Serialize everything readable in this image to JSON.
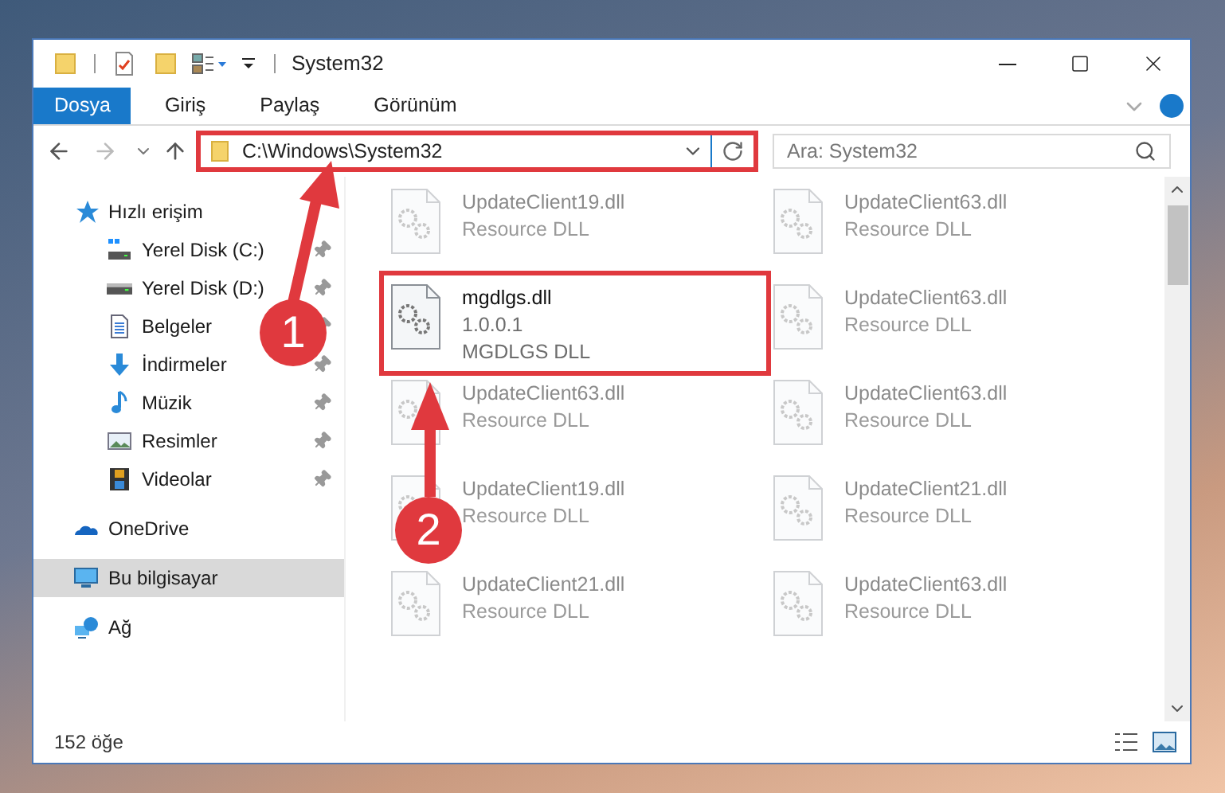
{
  "window": {
    "title": "System32"
  },
  "ribbon_tabs": [
    {
      "label": "Dosya",
      "selected": true
    },
    {
      "label": "Giriş",
      "selected": false
    },
    {
      "label": "Paylaş",
      "selected": false
    },
    {
      "label": "Görünüm",
      "selected": false
    }
  ],
  "address": {
    "path": "C:\\Windows\\System32",
    "highlighted": true
  },
  "search": {
    "placeholder": "Ara: System32"
  },
  "sidebar": {
    "items": [
      {
        "label": "Hızlı erişim",
        "kind": "star",
        "selected": false,
        "children": [
          {
            "label": "Yerel Disk (C:)",
            "kind": "system-drive",
            "pinned": true,
            "selected": false
          },
          {
            "label": "Yerel Disk (D:)",
            "kind": "drive",
            "pinned": true,
            "selected": false
          },
          {
            "label": "Belgeler",
            "kind": "document",
            "pinned": true,
            "selected": false
          },
          {
            "label": "İndirmeler",
            "kind": "download",
            "pinned": true,
            "selected": false
          },
          {
            "label": "Müzik",
            "kind": "music",
            "pinned": true,
            "selected": false
          },
          {
            "label": "Resimler",
            "kind": "pictures",
            "pinned": true,
            "selected": false
          },
          {
            "label": "Videolar",
            "kind": "video",
            "pinned": true,
            "selected": false
          }
        ]
      },
      {
        "label": "OneDrive",
        "kind": "cloud",
        "selected": false
      },
      {
        "label": "Bu bilgisayar",
        "kind": "computer",
        "selected": true
      },
      {
        "label": "Ağ",
        "kind": "network",
        "selected": false
      }
    ]
  },
  "files": [
    {
      "name": "UpdateClient19.dll",
      "details": [
        "Resource DLL"
      ],
      "blurred": true,
      "highlighted": false
    },
    {
      "name": "UpdateClient63.dll",
      "details": [
        "Resource DLL"
      ],
      "blurred": true,
      "highlighted": false
    },
    {
      "name": "mgdlgs.dll",
      "details": [
        "1.0.0.1",
        "MGDLGS DLL"
      ],
      "blurred": false,
      "highlighted": true
    },
    {
      "name": "UpdateClient63.dll",
      "details": [
        "Resource DLL"
      ],
      "blurred": true,
      "highlighted": false
    },
    {
      "name": "UpdateClient63.dll",
      "details": [
        "Resource DLL"
      ],
      "blurred": true,
      "highlighted": false
    },
    {
      "name": "UpdateClient63.dll",
      "details": [
        "Resource DLL"
      ],
      "blurred": true,
      "highlighted": false
    },
    {
      "name": "UpdateClient19.dll",
      "details": [
        "Resource DLL"
      ],
      "blurred": true,
      "highlighted": false
    },
    {
      "name": "UpdateClient21.dll",
      "details": [
        "Resource DLL"
      ],
      "blurred": true,
      "highlighted": false
    },
    {
      "name": "UpdateClient21.dll",
      "details": [
        "Resource DLL"
      ],
      "blurred": true,
      "highlighted": false
    },
    {
      "name": "UpdateClient63.dll",
      "details": [
        "Resource DLL"
      ],
      "blurred": true,
      "highlighted": false
    }
  ],
  "status_bar": {
    "count": "152 öğe"
  },
  "annotations": [
    {
      "label": "1"
    },
    {
      "label": "2"
    }
  ]
}
